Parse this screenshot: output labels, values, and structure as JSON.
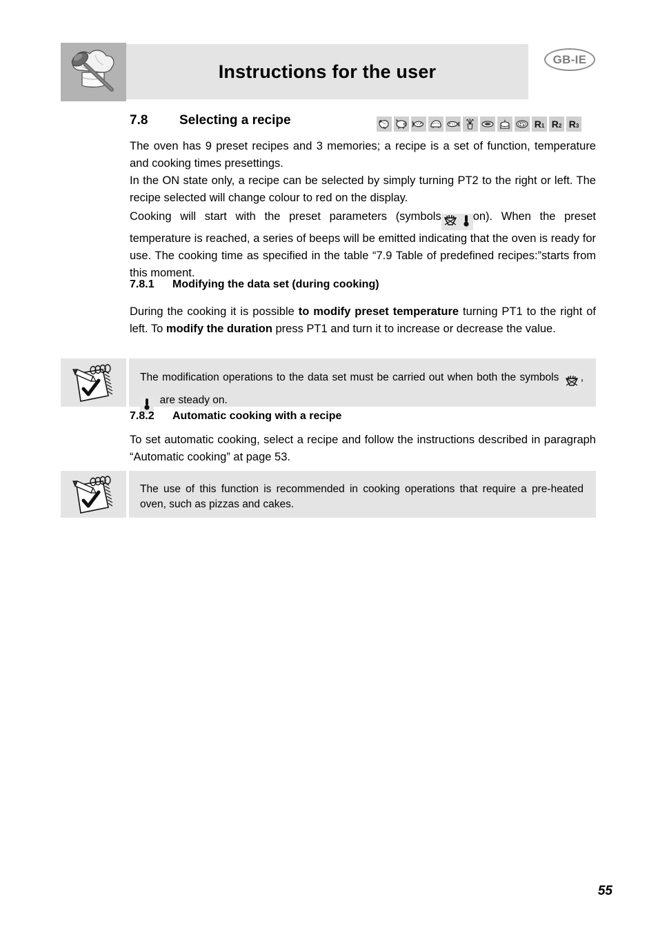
{
  "header": {
    "title": "Instructions for the user",
    "language_badge": "GB-IE",
    "brand_icon": "chef-hat-spoon-icon"
  },
  "sections": {
    "s78": {
      "number": "7.8",
      "title": "Selecting a recipe",
      "paragraph1": "The oven has 9 preset recipes and 3 memories; a recipe is a set of function, temperature and cooking times presettings.",
      "paragraph2": "In the ON state only, a recipe can be selected by simply turning PT2 to the right or left. The recipe selected will change colour to red on the display.",
      "paragraph3_part1": "Cooking will start with the preset parameters (symbols",
      "paragraph3_part2": "on). When the preset temperature is reached, a series of beeps will be emitted indicating that the oven is ready for use. The cooking time as specified in the table “7.9 Table of predefined recipes:”starts from this moment."
    },
    "s781": {
      "number": "7.8.1",
      "title": "Modifying the data set (during cooking)",
      "text_part1": "During the cooking it is possible ",
      "text_bold1": "to modify preset temperature",
      "text_part2": " turning PT1 to the right of left. To  ",
      "text_bold2": "modify the duration",
      "text_part3": " press PT1 and turn it to increase or decrease the value."
    },
    "s782": {
      "number": "7.8.2",
      "title": "Automatic cooking with a recipe",
      "text": "To set automatic cooking, select a recipe and follow the instructions described in paragraph “Automatic cooking” at page 53."
    }
  },
  "notes": [
    {
      "icon": "notepad-checkmark-icon",
      "text_part1": "The modification operations to the data set must be carried out when both the symbols",
      "text_separator": ",",
      "text_part2": "are steady on."
    },
    {
      "icon": "notepad-checkmark-icon",
      "text": "The use of this function is recommended in cooking operations that require a pre-heated oven, such as pizzas and cakes."
    }
  ],
  "recipe_symbols": [
    {
      "name": "poultry-chicken-icon",
      "label": ""
    },
    {
      "name": "pork-pig-icon",
      "label": ""
    },
    {
      "name": "fish-icon",
      "label": ""
    },
    {
      "name": "roast-meat-icon",
      "label": ""
    },
    {
      "name": "whole-fish-icon",
      "label": ""
    },
    {
      "name": "vegetables-icon",
      "label": ""
    },
    {
      "name": "bread-loaf-icon",
      "label": ""
    },
    {
      "name": "cake-icon",
      "label": ""
    },
    {
      "name": "pizza-icon",
      "label": ""
    },
    {
      "name": "memory-r1-icon",
      "label": "R",
      "sub": "1"
    },
    {
      "name": "memory-r2-icon",
      "label": "R",
      "sub": "2"
    },
    {
      "name": "memory-r3-icon",
      "label": "R",
      "sub": "3"
    }
  ],
  "inline_symbols": {
    "cooking_pan": "cooking-pan-symbol-icon",
    "thermometer": "thermometer-symbol-icon"
  },
  "page_number": "55",
  "colors": {
    "header_banner_bg": "#e4e4e4",
    "brand_icon_bg": "#b3b3b3",
    "note_bg": "#e4e4e4",
    "symbol_tile_bg": "#cfcfcf",
    "badge_stroke": "#8d8d8d",
    "badge_text": "#7d7d7d"
  }
}
